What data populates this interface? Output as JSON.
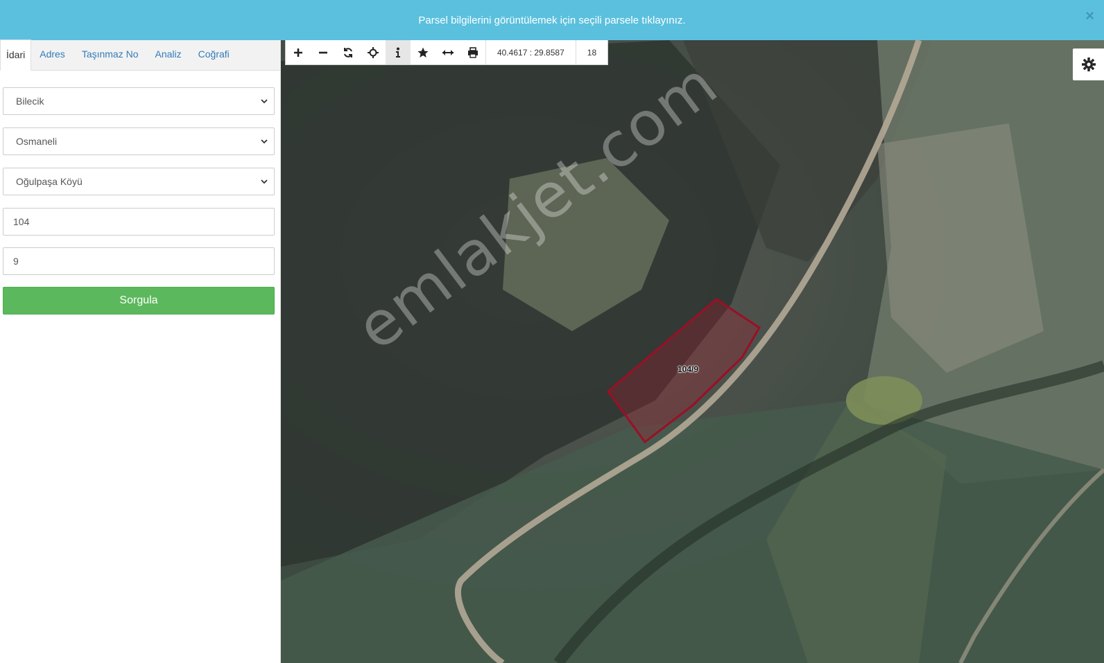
{
  "banner": {
    "message": "Parsel bilgilerini görüntülemek için seçili parsele tıklayınız.",
    "close_icon": "close-icon"
  },
  "tabs": [
    {
      "label": "İdari",
      "active": true
    },
    {
      "label": "Adres",
      "active": false
    },
    {
      "label": "Taşınmaz No",
      "active": false
    },
    {
      "label": "Analiz",
      "active": false
    },
    {
      "label": "Coğrafi",
      "active": false
    }
  ],
  "form": {
    "province": "Bilecik",
    "district": "Osmaneli",
    "neighborhood": "Oğulpaşa Köyü",
    "block": "104",
    "parcel": "9",
    "submit_label": "Sorgula"
  },
  "toolbar": {
    "buttons": [
      "zoom-in-icon",
      "zoom-out-icon",
      "refresh-icon",
      "locate-icon",
      "info-icon",
      "star-icon",
      "measure-icon",
      "print-icon"
    ],
    "active_button": "info-icon",
    "coordinates": "40.4617 : 29.8587",
    "zoom_level": "18"
  },
  "map": {
    "parcel_label": "104/9",
    "watermark": "emlakjet.com",
    "parcel_color": "#c0142c"
  },
  "colors": {
    "banner": "#5bc0de",
    "primary_button": "#5cb85c",
    "link": "#337ab7"
  }
}
